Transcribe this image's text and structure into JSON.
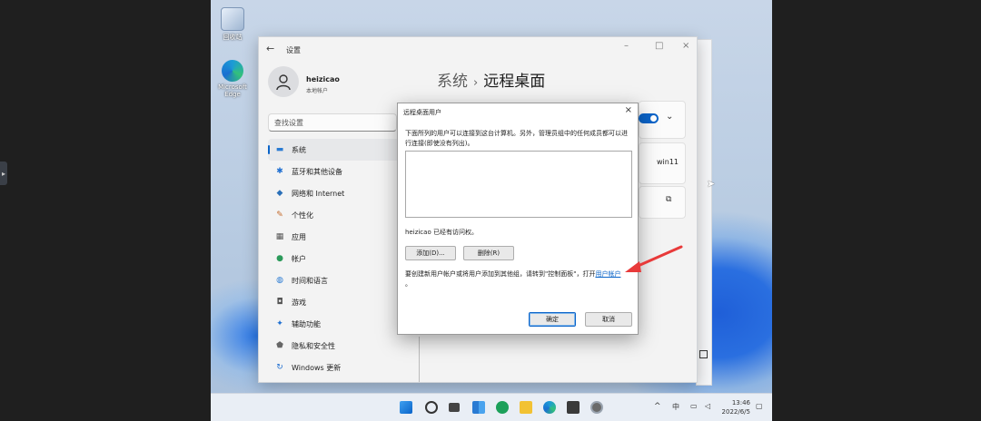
{
  "desktop": {
    "icons": [
      {
        "label": "回收站"
      },
      {
        "label": "Microsoft Edge"
      }
    ]
  },
  "settings": {
    "title": "设置",
    "profile": {
      "name": "heizicao",
      "type": "本地帐户"
    },
    "search_placeholder": "查找设置",
    "nav": [
      {
        "label": "系统",
        "icon": "monitor-icon"
      },
      {
        "label": "蓝牙和其他设备",
        "icon": "bluetooth-icon"
      },
      {
        "label": "网络和 Internet",
        "icon": "wifi-icon"
      },
      {
        "label": "个性化",
        "icon": "brush-icon"
      },
      {
        "label": "应用",
        "icon": "apps-icon"
      },
      {
        "label": "帐户",
        "icon": "person-icon"
      },
      {
        "label": "时间和语言",
        "icon": "globe-icon"
      },
      {
        "label": "游戏",
        "icon": "gamepad-icon"
      },
      {
        "label": "辅助功能",
        "icon": "accessibility-icon"
      },
      {
        "label": "隐私和安全性",
        "icon": "shield-icon"
      },
      {
        "label": "Windows 更新",
        "icon": "update-icon"
      }
    ],
    "breadcrumb": {
      "parent": "系统",
      "current": "远程桌面"
    },
    "device_name": "win11"
  },
  "dialog": {
    "title": "远程桌面用户",
    "close": "×",
    "description": "下面所列的用户可以连接到这台计算机。另外，管理员组中的任何成员都可以进行连接(即使没有列出)。",
    "access_note": "heizicao 已经有访问权。",
    "add_button": "添加(D)...",
    "remove_button": "删除(R)",
    "hint_prefix": "要创建新用户帐户或将用户添加到其他组，请转到\"控制面板\"，打开",
    "hint_link": "用户帐户",
    "hint_suffix": "。",
    "ok_button": "确定",
    "cancel_button": "取消"
  },
  "taskbar": {
    "ime": "中",
    "time": "13:46",
    "date": "2022/6/5"
  },
  "colors": {
    "accent": "#0a64c9",
    "annotation_arrow": "#e83a3a"
  }
}
